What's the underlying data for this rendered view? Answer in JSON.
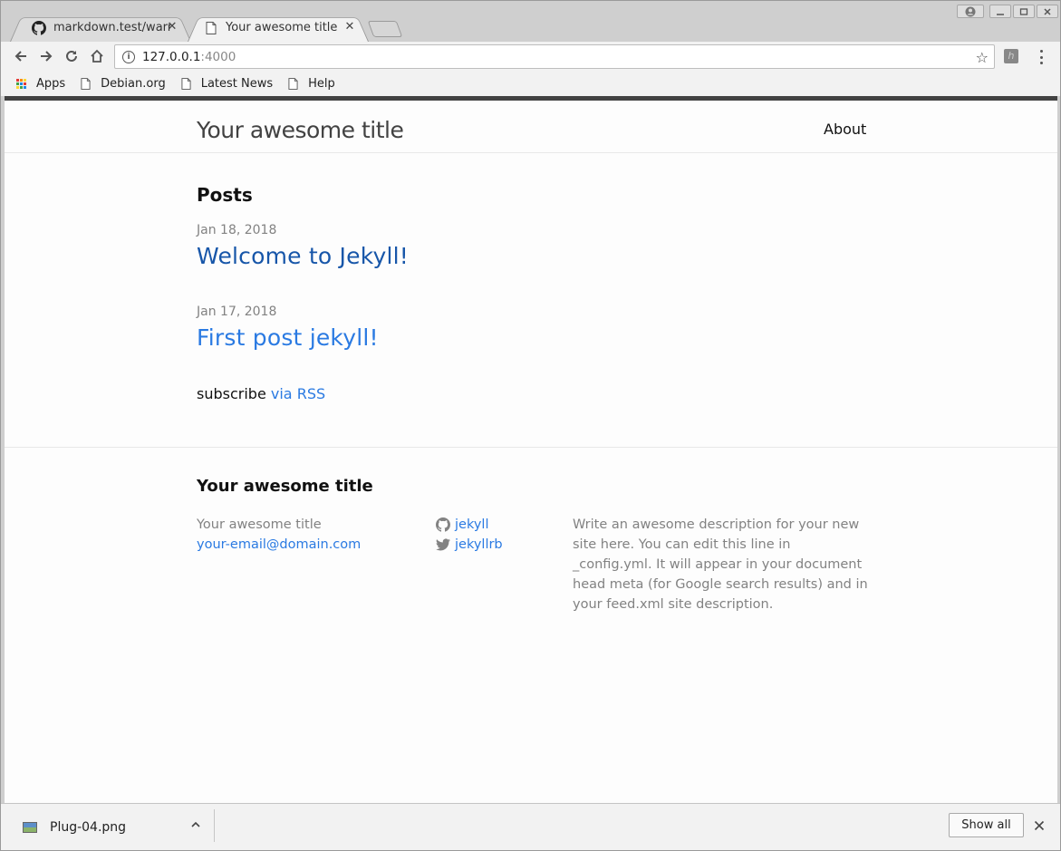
{
  "browser": {
    "tabs": [
      {
        "label": "markdown.test/warni",
        "icon": "github-icon",
        "close": "✕"
      },
      {
        "label": "Your awesome title",
        "icon": "page-icon",
        "close": "✕"
      }
    ],
    "address": {
      "host": "127.0.0.1",
      "port": ":4000"
    },
    "bookmarks": [
      {
        "label": "Apps",
        "icon": "apps-grid-icon"
      },
      {
        "label": "Debian.org",
        "icon": "page-icon"
      },
      {
        "label": "Latest News",
        "icon": "page-icon"
      },
      {
        "label": "Help",
        "icon": "page-icon"
      }
    ]
  },
  "site": {
    "title": "Your awesome title",
    "nav": {
      "about": "About"
    },
    "posts_heading": "Posts",
    "posts": [
      {
        "date": "Jan 18, 2018",
        "title": "Welcome to Jekyll!"
      },
      {
        "date": "Jan 17, 2018",
        "title": "First post jekyll!"
      }
    ],
    "subscribe": {
      "text": "subscribe",
      "link": "via RSS"
    },
    "footer": {
      "heading": "Your awesome title",
      "name": "Your awesome title",
      "email": "your-email@domain.com",
      "github": "jekyll",
      "twitter": "jekyllrb",
      "description": "Write an awesome description for your new site here. You can edit this line in _config.yml. It will appear in your document head meta (for Google search results) and in your feed.xml site description."
    }
  },
  "downloads": {
    "file": "Plug-04.png",
    "show_all": "Show all"
  },
  "colors": {
    "link": "#2a7ae2",
    "visited_link": "#1756a9",
    "muted": "#828282",
    "header_bar": "#424242"
  }
}
